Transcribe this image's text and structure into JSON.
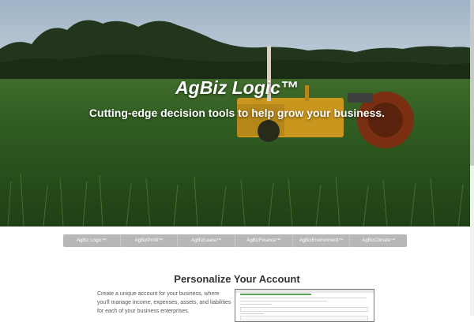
{
  "hero": {
    "title": "AgBiz Logic™",
    "subtitle": "Cutting-edge decision tools to help grow your business."
  },
  "nav": {
    "items": [
      {
        "label": "AgBiz Logic™"
      },
      {
        "label": "AgBizProfit™"
      },
      {
        "label": "AgBizLease™"
      },
      {
        "label": "AgBizFinance™"
      },
      {
        "label": "AgBizEnvironment™"
      },
      {
        "label": "AgBizClimate™"
      }
    ]
  },
  "section": {
    "title": "Personalize Your Account",
    "description": "Create a unique account for your business, where you'll manage income, expenses, assets, and liabilities for each of your business enterprises."
  },
  "colors": {
    "nav_bg": "#b7b7b7",
    "progress_green": "#56a35a"
  }
}
